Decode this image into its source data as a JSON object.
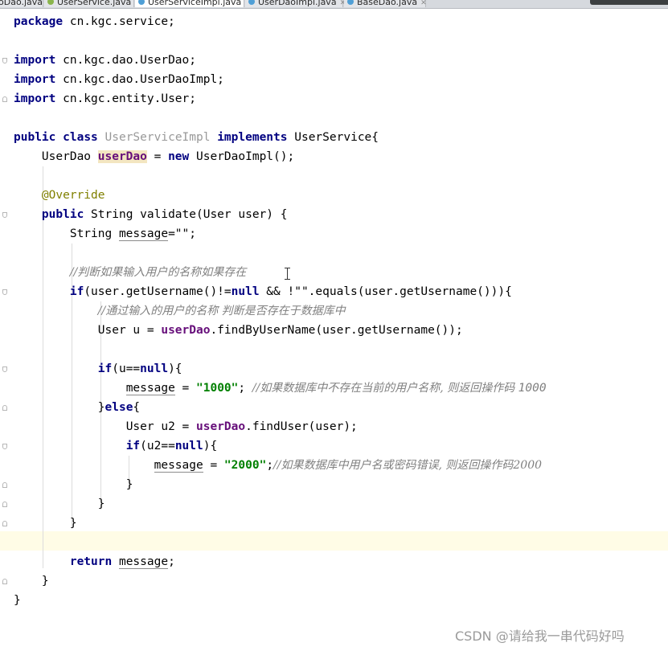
{
  "tabs": [
    {
      "label": "oDao.java",
      "icon": "interface-icon",
      "active": false
    },
    {
      "label": "UserService.java",
      "icon": "interface-icon",
      "active": false
    },
    {
      "label": "UserServiceImpl.java",
      "icon": "class-icon",
      "active": true
    },
    {
      "label": "UserDaoImpl.java",
      "icon": "class-icon",
      "active": false
    },
    {
      "label": "BaseDao.java",
      "icon": "class-icon",
      "active": false
    }
  ],
  "code": {
    "l1": {
      "kw": "package",
      "rest": " cn.kgc.service;"
    },
    "l3": {
      "kw": "import",
      "rest": " cn.kgc.dao.UserDao;"
    },
    "l4": {
      "kw": "import",
      "rest": " cn.kgc.dao.UserDaoImpl;"
    },
    "l5": {
      "kw": "import",
      "rest": " cn.kgc.entity.User;"
    },
    "l7": {
      "kw1": "public",
      "kw2": "class",
      "name": "UserServiceImpl",
      "kw3": "implements",
      "rest": " UserService{"
    },
    "l8": {
      "t1": "UserDao ",
      "field": "userDao",
      "t2": " = ",
      "kw": "new",
      "t3": " UserDaoImpl();"
    },
    "l10": {
      "ann": "@Override"
    },
    "l11": {
      "kw": "public",
      "rest": " String validate(User user) {"
    },
    "l12": {
      "t1": "String ",
      "var": "message",
      "t2": "=\"\";"
    },
    "l14": {
      "comment": "//判断如果输入用户的名称如果存在"
    },
    "l15": {
      "kw": "if",
      "t1": "(user.getUsername()!=",
      "kw2": "null",
      "t2": " && !\"\".equals(user.getUsername())){"
    },
    "l16": {
      "comment": "//通过输入的用户的名称 判断是否存在于数据库中"
    },
    "l17": {
      "t1": "User u = ",
      "field": "userDao",
      "t2": ".findByUserName(user.getUsername());"
    },
    "l19": {
      "kw": "if",
      "t1": "(u==",
      "kw2": "null",
      "t2": "){"
    },
    "l20": {
      "var": "message",
      "t1": " = ",
      "str": "\"1000\"",
      "t2": "; ",
      "comment": "//如果数据库中不存在当前的用户名称, 则返回操作码 ",
      "comment_code": "1000"
    },
    "l21": {
      "t1": "}",
      "kw": "else",
      "t2": "{"
    },
    "l22": {
      "t1": "User u2 = ",
      "field": "userDao",
      "t2": ".findUser(user);"
    },
    "l23": {
      "kw": "if",
      "t1": "(u2==",
      "kw2": "null",
      "t2": "){"
    },
    "l24": {
      "var": "message",
      "t1": " = ",
      "str": "\"2000\"",
      "t2": ";",
      "comment": "//如果数据库中用户名或密码错误, 则返回操作码2000"
    },
    "l25": {
      "t": "}"
    },
    "l26": {
      "t": "}"
    },
    "l27": {
      "t": "}"
    },
    "l29": {
      "kw": "return",
      "t1": " ",
      "var": "message",
      "t2": ";"
    },
    "l30": {
      "t": "}"
    },
    "l31": {
      "t": "}"
    }
  },
  "watermark": "CSDN @请给我一串代码好吗",
  "colors": {
    "keyword": "#000080",
    "string": "#008000",
    "field": "#660e7a",
    "comment": "#808080",
    "annotation": "#808000",
    "unused_class": "#999999",
    "caret_row": "#fffce6"
  }
}
